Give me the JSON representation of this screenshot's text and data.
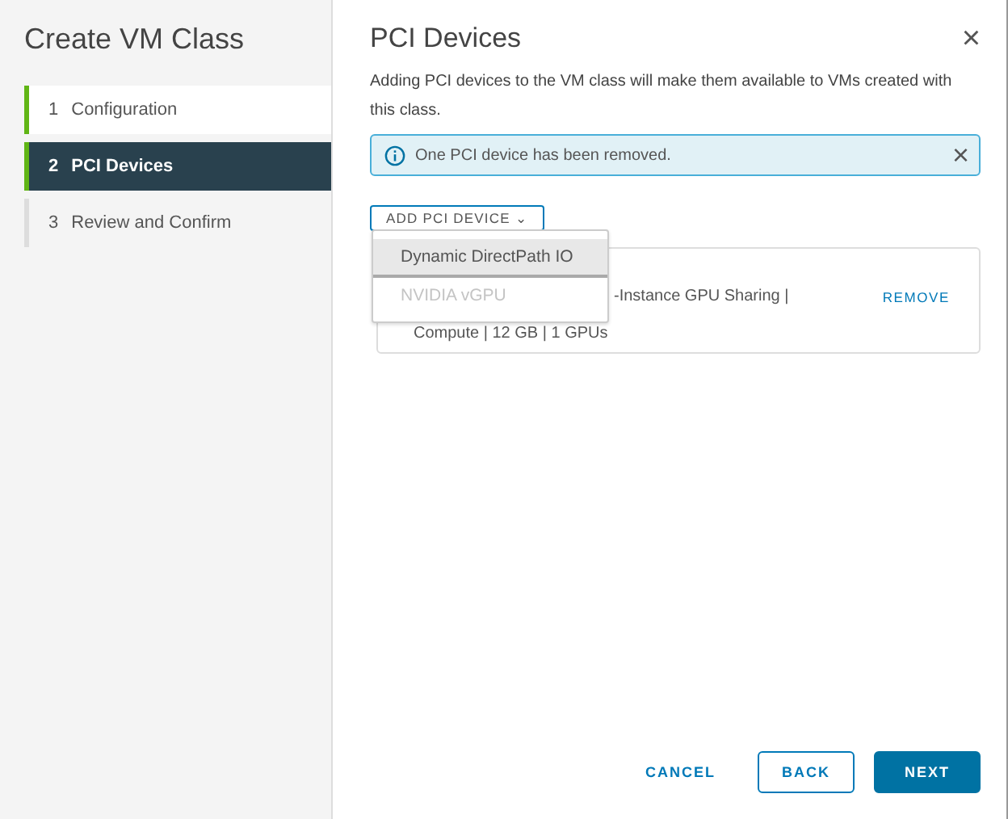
{
  "wizard": {
    "title": "Create VM Class"
  },
  "steps": [
    {
      "number": "1",
      "label": "Configuration",
      "selected": false,
      "done": true
    },
    {
      "number": "2",
      "label": "PCI Devices",
      "selected": true,
      "done": true
    },
    {
      "number": "3",
      "label": "Review and Confirm",
      "selected": false,
      "done": false
    }
  ],
  "page": {
    "title": "PCI Devices",
    "close": "×",
    "description": "Adding PCI devices to the VM class will make them available to VMs created with this class."
  },
  "alert": {
    "message": "One PCI device has been removed.",
    "close": "×"
  },
  "add_button": {
    "label": "ADD PCI DEVICE",
    "caret": "⌄"
  },
  "dropdown": {
    "items": [
      {
        "label": "Dynamic DirectPath IO",
        "highlighted": true,
        "disabled": false
      },
      {
        "label": "NVIDIA vGPU",
        "highlighted": false,
        "disabled": true
      }
    ]
  },
  "device_card": {
    "line_1": "-Instance GPU Sharing |",
    "line_2": "Compute | 12 GB | 1 GPUs",
    "remove": "REMOVE"
  },
  "footer": {
    "cancel": "CANCEL",
    "back": "BACK",
    "next": "NEXT"
  }
}
